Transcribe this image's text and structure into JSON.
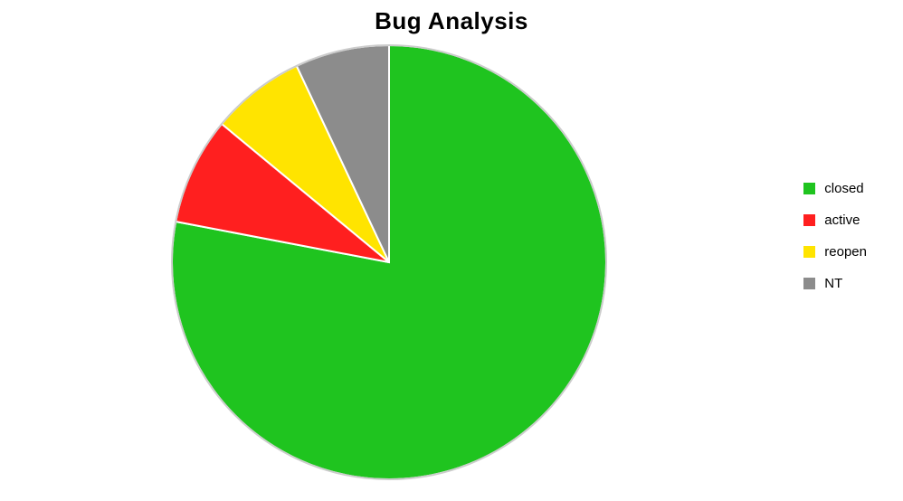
{
  "chart_data": {
    "type": "pie",
    "title": "Bug Analysis",
    "series": [
      {
        "name": "closed",
        "value": 78,
        "color": "#1fc41f"
      },
      {
        "name": "active",
        "value": 8,
        "color": "#ff1f1f"
      },
      {
        "name": "reopen",
        "value": 7,
        "color": "#ffe400"
      },
      {
        "name": "NT",
        "value": 7,
        "color": "#8c8c8c"
      }
    ],
    "stroke": "#cccccc",
    "gap_stroke": "#ffffff"
  }
}
